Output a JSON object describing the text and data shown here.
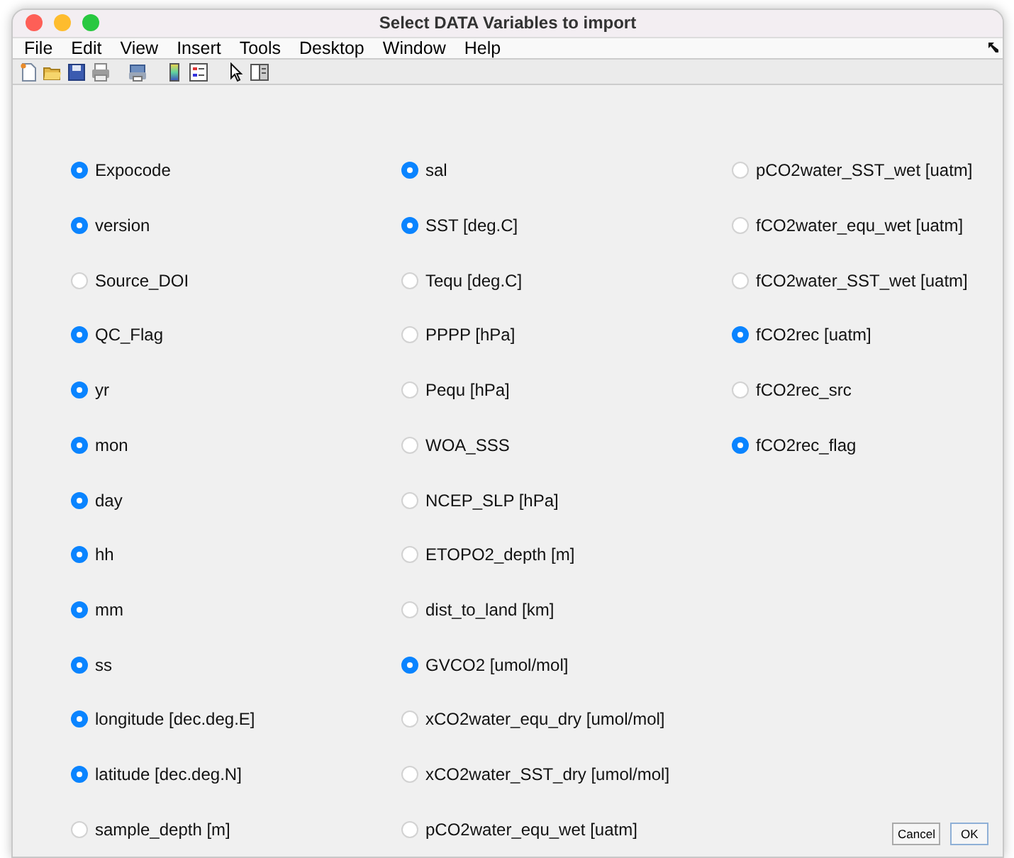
{
  "window": {
    "title": "Select DATA Variables to import"
  },
  "menu": [
    "File",
    "Edit",
    "View",
    "Insert",
    "Tools",
    "Desktop",
    "Window",
    "Help"
  ],
  "toolbar": [
    {
      "kind": "new"
    },
    {
      "kind": "open"
    },
    {
      "kind": "save"
    },
    {
      "kind": "print"
    },
    {
      "kind": "gap"
    },
    {
      "kind": "printer2"
    },
    {
      "kind": "gap"
    },
    {
      "kind": "colorbar"
    },
    {
      "kind": "legend"
    },
    {
      "kind": "gap"
    },
    {
      "kind": "pointer"
    },
    {
      "kind": "panel"
    }
  ],
  "columns": [
    [
      {
        "label": "Expocode",
        "checked": true
      },
      {
        "label": "version",
        "checked": true
      },
      {
        "label": "Source_DOI",
        "checked": false
      },
      {
        "label": "QC_Flag",
        "checked": true
      },
      {
        "label": "yr",
        "checked": true
      },
      {
        "label": "mon",
        "checked": true
      },
      {
        "label": "day",
        "checked": true
      },
      {
        "label": "hh",
        "checked": true
      },
      {
        "label": "mm",
        "checked": true
      },
      {
        "label": "ss",
        "checked": true
      },
      {
        "label": "longitude [dec.deg.E]",
        "checked": true
      },
      {
        "label": "latitude [dec.deg.N]",
        "checked": true
      },
      {
        "label": "sample_depth [m]",
        "checked": false
      }
    ],
    [
      {
        "label": "sal",
        "checked": true
      },
      {
        "label": "SST [deg.C]",
        "checked": true
      },
      {
        "label": "Tequ [deg.C]",
        "checked": false
      },
      {
        "label": "PPPP [hPa]",
        "checked": false
      },
      {
        "label": "Pequ [hPa]",
        "checked": false
      },
      {
        "label": "WOA_SSS",
        "checked": false
      },
      {
        "label": "NCEP_SLP [hPa]",
        "checked": false
      },
      {
        "label": "ETOPO2_depth [m]",
        "checked": false
      },
      {
        "label": "dist_to_land [km]",
        "checked": false
      },
      {
        "label": "GVCO2 [umol/mol]",
        "checked": true
      },
      {
        "label": "xCO2water_equ_dry [umol/mol]",
        "checked": false
      },
      {
        "label": "xCO2water_SST_dry [umol/mol]",
        "checked": false
      },
      {
        "label": "pCO2water_equ_wet [uatm]",
        "checked": false
      }
    ],
    [
      {
        "label": "pCO2water_SST_wet [uatm]",
        "checked": false
      },
      {
        "label": "fCO2water_equ_wet [uatm]",
        "checked": false
      },
      {
        "label": "fCO2water_SST_wet [uatm]",
        "checked": false
      },
      {
        "label": "fCO2rec [uatm]",
        "checked": true
      },
      {
        "label": "fCO2rec_src",
        "checked": false
      },
      {
        "label": "fCO2rec_flag",
        "checked": true
      }
    ]
  ],
  "buttons": [
    "Cancel",
    "OK"
  ]
}
